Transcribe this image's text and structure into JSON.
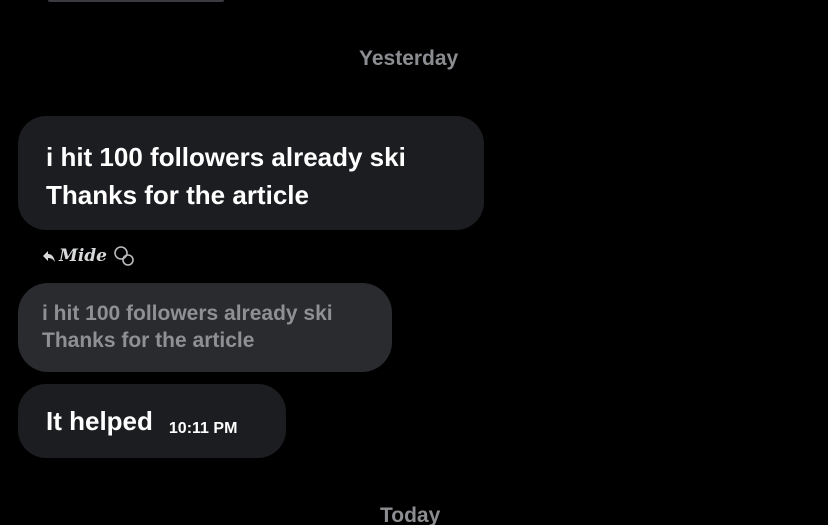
{
  "separators": {
    "yesterday": "Yesterday",
    "today": "Today"
  },
  "messages": {
    "received": {
      "line1": "i hit 100 followers already ski",
      "line2": "Thanks for the article"
    },
    "reply": {
      "author": "Mide",
      "author_icon": "double-circle-icon",
      "quoted_line1": "i hit 100 followers already ski",
      "quoted_line2": "Thanks for the article",
      "text": "It helped",
      "time": "10:11 PM"
    }
  },
  "colors": {
    "background": "#000000",
    "bubble": "#1c1d20",
    "quoted_bubble": "#2a2b2f",
    "muted_text": "#8b8d91"
  }
}
